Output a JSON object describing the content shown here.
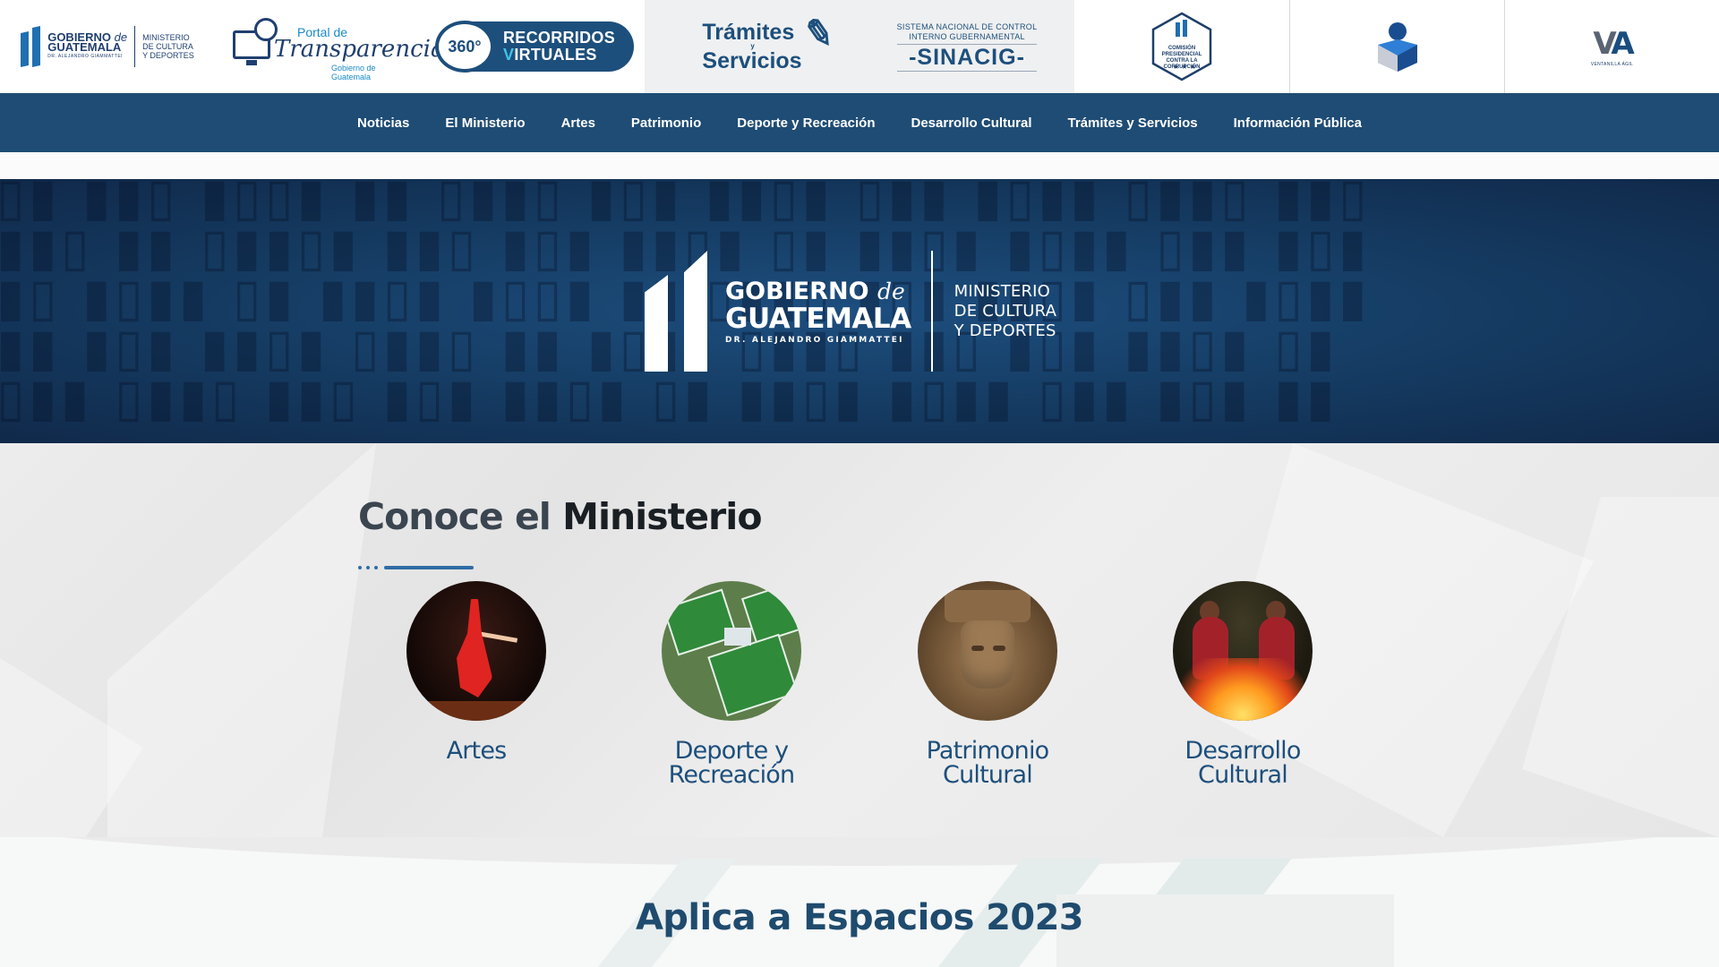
{
  "topbar": {
    "gobierno": {
      "line1": "GOBIERNO",
      "de": "de",
      "line2": "GUATEMALA",
      "president": "DR. ALEJANDRO GIAMMATTEI",
      "ministry_l1": "MINISTERIO",
      "ministry_l2": "DE CULTURA",
      "ministry_l3": "Y DEPORTES"
    },
    "portal": {
      "line1": "Portal de",
      "line2": "Transparencia",
      "line3": "Gobierno de Guatemala"
    },
    "recorridos": {
      "badge": "360°",
      "line1": "RECORRIDOS",
      "line2_first": "V",
      "line2_rest": "IRTUALES"
    },
    "tramites": {
      "line1": "Trámites",
      "conj": "y",
      "line2": "Servicios"
    },
    "sinacig": {
      "line1": "SISTEMA NACIONAL DE CONTROL",
      "line2": "INTERNO GUBERNAMENTAL",
      "line3": "-SINACIG-"
    },
    "corrupcion": {
      "line1": "COMISIÓN PRESIDENCIAL",
      "line2": "CONTRA LA CORRUPCIÓN"
    },
    "ventanilla": {
      "logo_v": "V",
      "logo_a": "A",
      "line1": "VENTANILLA ÁGIL"
    }
  },
  "nav": {
    "items": [
      "Noticias",
      "El Ministerio",
      "Artes",
      "Patrimonio",
      "Deporte y Recreación",
      "Desarrollo Cultural",
      "Trámites y Servicios",
      "Información Pública"
    ]
  },
  "hero": {
    "gob_line1": "GOBIERNO",
    "gob_de": "de",
    "gob_line2": "GUATEMALA",
    "gob_line3": "DR. ALEJANDRO GIAMMATTEI",
    "min_line1": "MINISTERIO",
    "min_line2": "DE CULTURA",
    "min_line3": "Y DEPORTES"
  },
  "conoce": {
    "title_light": "Conoce el",
    "title_bold": "Ministerio",
    "cards": [
      {
        "line1": "Artes",
        "line2": ""
      },
      {
        "line1": "Deporte y",
        "line2": "Recreación"
      },
      {
        "line1": "Patrimonio",
        "line2": "Cultural"
      },
      {
        "line1": "Desarrollo",
        "line2": "Cultural"
      }
    ]
  },
  "aplica": {
    "title": "Aplica a Espacios 2023"
  },
  "colors": {
    "nav_bg": "#1e4c74",
    "hero_bg": "#163e66",
    "accent": "#1d4f7c",
    "heading": "#1f4b6e"
  }
}
